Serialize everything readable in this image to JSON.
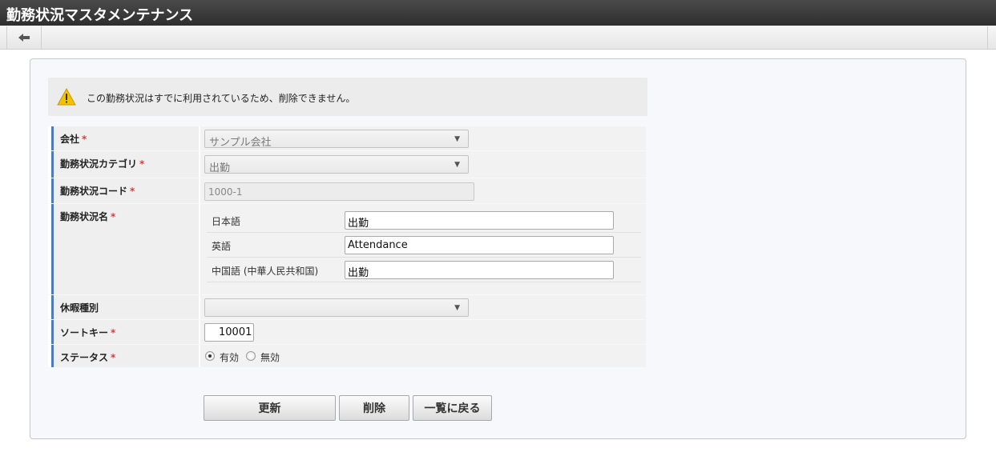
{
  "window": {
    "title": "勤務状況マスタメンテナンス"
  },
  "toolbar": {
    "back_icon": "arrow-left-icon"
  },
  "warning": {
    "icon": "warning-icon",
    "message": "この勤務状況はすでに利用されているため、削除できません。"
  },
  "form": {
    "company": {
      "label": "会社",
      "required_mark": "*",
      "value": "サンプル会社"
    },
    "category": {
      "label": "勤務状況カテゴリ",
      "required_mark": "*",
      "value": "出勤"
    },
    "code": {
      "label": "勤務状況コード",
      "required_mark": "*",
      "value": "1000-1"
    },
    "name": {
      "label": "勤務状況名",
      "required_mark": "*",
      "languages": [
        {
          "label": "日本語",
          "value": "出勤"
        },
        {
          "label": "英語",
          "value": "Attendance"
        },
        {
          "label": "中国語 (中華人民共和国)",
          "value": "出勤"
        }
      ]
    },
    "leave_type": {
      "label": "休暇種別",
      "value": ""
    },
    "sort_key": {
      "label": "ソートキー",
      "required_mark": "*",
      "value": "10001"
    },
    "status": {
      "label": "ステータス",
      "required_mark": "*",
      "options": [
        {
          "label": "有効",
          "checked": true
        },
        {
          "label": "無効",
          "checked": false
        }
      ]
    }
  },
  "buttons": {
    "update": "更新",
    "delete": "削除",
    "back_to_list": "一覧に戻る"
  },
  "colors": {
    "titlebar": "#3a3a3a",
    "label_accent": "#4f7bb8",
    "required": "#e03a3a",
    "warning_icon": "#f2c200"
  }
}
